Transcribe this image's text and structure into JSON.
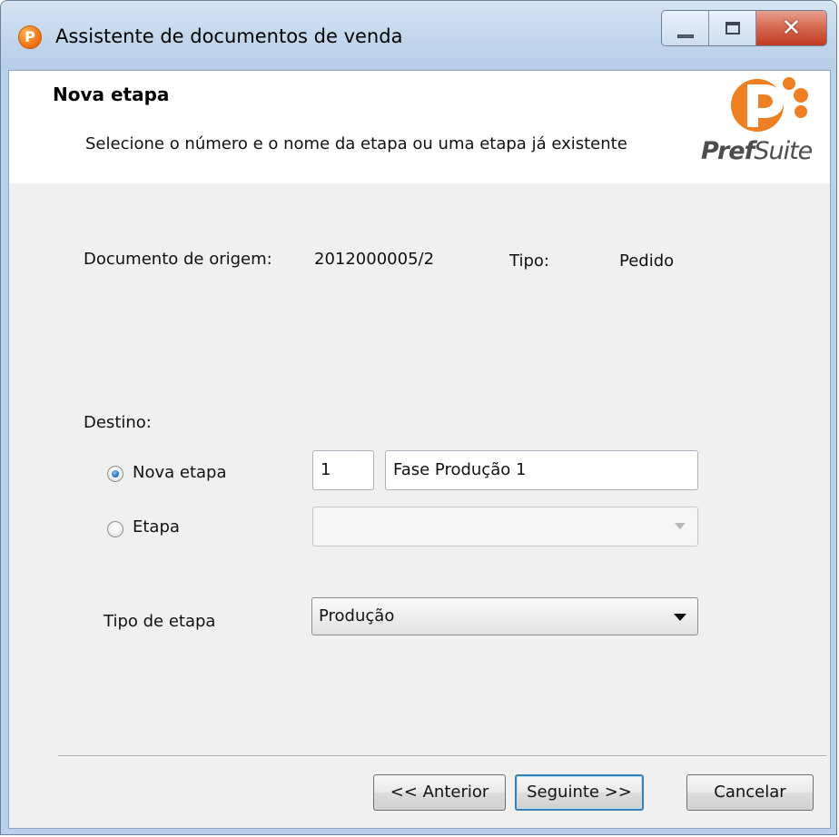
{
  "window": {
    "title": "Assistente de documentos de venda",
    "icon": "prefsuite-logo-icon",
    "controls": [
      "minimize-icon",
      "maximize-icon",
      "close-icon"
    ]
  },
  "header": {
    "title": "Nova etapa",
    "subtitle": "Selecione o número e o nome da etapa ou uma etapa já existente",
    "logo": {
      "text_pref": "Pref",
      "text_suite": "Suite",
      "accent_color": "#ee7f22"
    }
  },
  "source": {
    "document_label": "Documento de origem:",
    "document_value": "2012000005/2",
    "type_label": "Tipo:",
    "type_value": "Pedido"
  },
  "destination": {
    "label": "Destino:",
    "new_stage": {
      "label": "Nova etapa",
      "selected": true,
      "number_value": "1",
      "name_value": "Fase Produção 1"
    },
    "existing_stage": {
      "label": "Etapa",
      "selected": false,
      "value": ""
    },
    "stage_type": {
      "label": "Tipo de etapa",
      "value": "Produção"
    }
  },
  "buttons": {
    "previous": "<< Anterior",
    "next": "Seguinte >>",
    "cancel": "Cancelar"
  },
  "colors": {
    "titlebar": "#c5d9ee",
    "close_button": "#c0391e",
    "dialog_background": "#f0f0f0",
    "primary_button_border": "#3c7fb1"
  }
}
